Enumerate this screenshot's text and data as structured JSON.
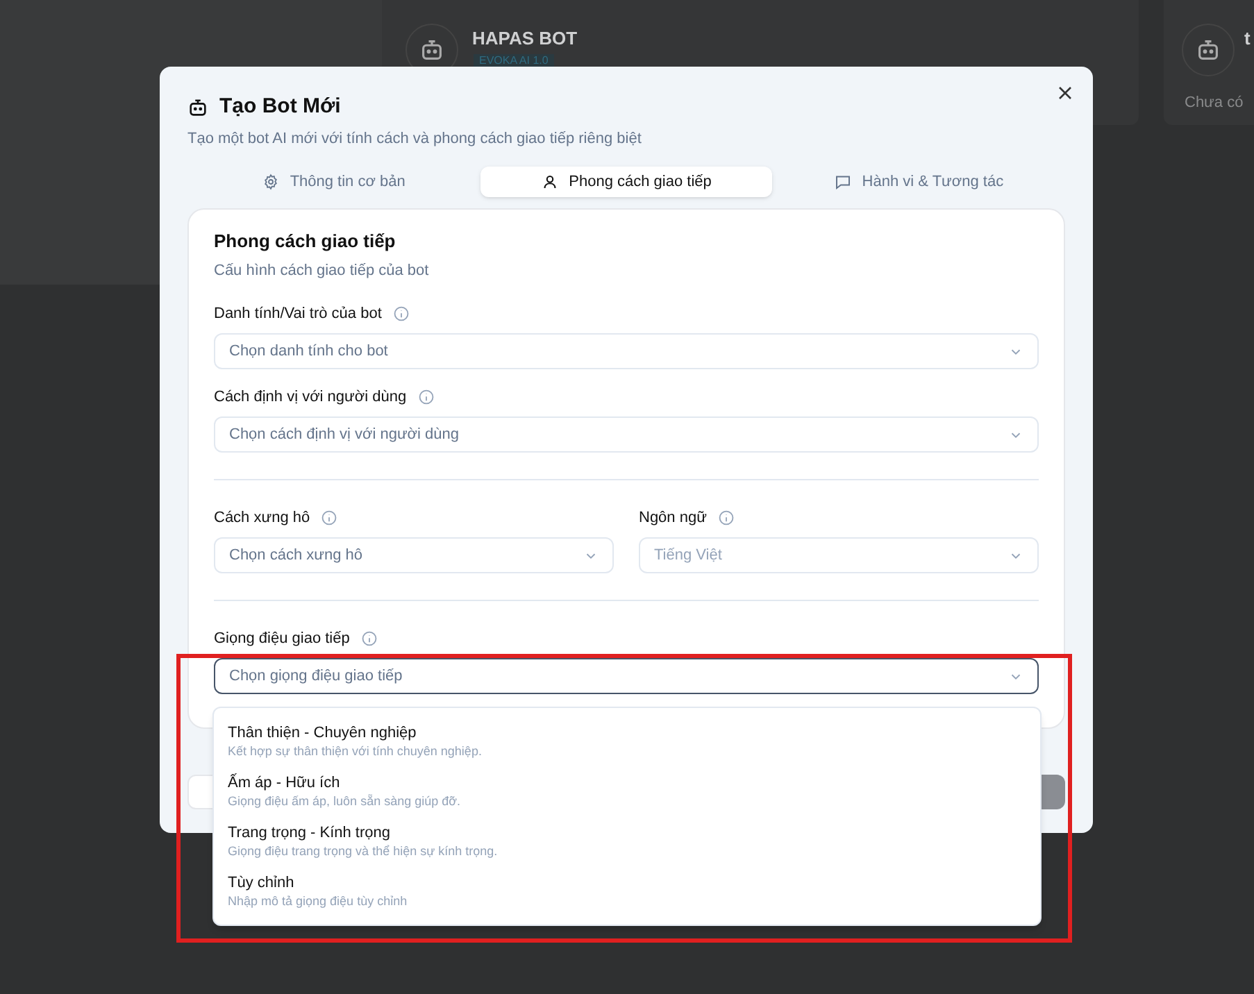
{
  "background": {
    "bot_cards": [
      {
        "name": "HAPAS BOT",
        "badge": "EVOKA AI 1.0"
      },
      {
        "name": "t",
        "caption": "Chưa có"
      }
    ]
  },
  "dialog": {
    "title": "Tạo Bot Mới",
    "subtitle": "Tạo một bot AI mới với tính cách và phong cách giao tiếp riêng biệt",
    "tabs": [
      {
        "label": "Thông tin cơ bản",
        "selected": false
      },
      {
        "label": "Phong cách giao tiếp",
        "selected": true
      },
      {
        "label": "Hành vi & Tương tác",
        "selected": false
      }
    ],
    "section": {
      "title": "Phong cách giao tiếp",
      "subtitle": "Cấu hình cách giao tiếp của bot"
    },
    "rows": [
      {
        "fields": [
          {
            "label": "Danh tính/Vai trò của bot",
            "placeholder": "Chọn danh tính cho bot",
            "disabled": false,
            "open": false
          }
        ]
      },
      {
        "fields": [
          {
            "label": "Cách định vị với người dùng",
            "placeholder": "Chọn cách định vị với người dùng",
            "disabled": false,
            "open": false
          }
        ]
      },
      {
        "divider_before": true,
        "fields": [
          {
            "label": "Cách xưng hô",
            "placeholder": "Chọn cách xưng hô",
            "disabled": false,
            "open": false
          },
          {
            "label": "Ngôn ngữ",
            "value": "Tiếng Việt",
            "disabled": true,
            "open": false
          }
        ]
      },
      {
        "divider_before": true,
        "fields": [
          {
            "label": "Giọng điệu giao tiếp",
            "placeholder": "Chọn giọng điệu giao tiếp",
            "disabled": false,
            "open": true
          }
        ]
      }
    ]
  },
  "dropdown": {
    "options": [
      {
        "title": "Thân thiện - Chuyên nghiệp",
        "description": "Kết hợp sự thân thiện với tính chuyên nghiệp."
      },
      {
        "title": "Ấm áp - Hữu ích",
        "description": "Giọng điệu ấm áp, luôn sẵn sàng giúp đỡ."
      },
      {
        "title": "Trang trọng - Kính trọng",
        "description": "Giọng điệu trang trọng và thể hiện sự kính trọng."
      },
      {
        "title": "Tùy chỉnh",
        "description": "Nhập mô tả giọng điệu tùy chỉnh"
      }
    ]
  }
}
